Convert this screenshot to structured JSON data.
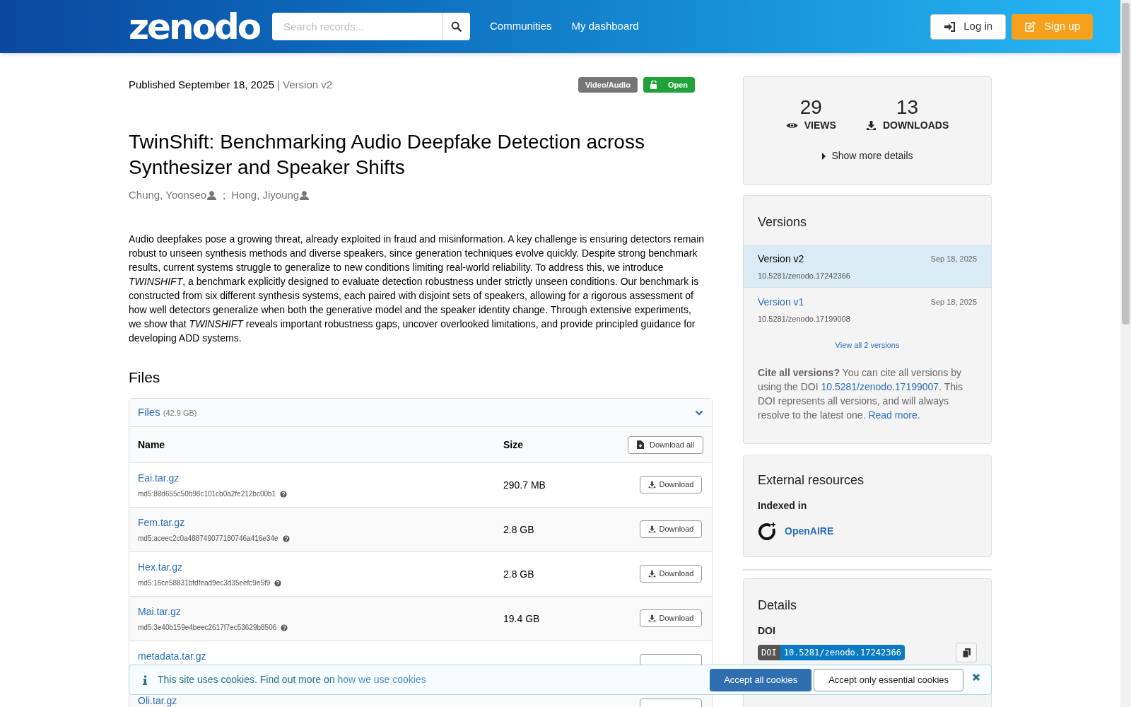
{
  "header": {
    "logo": "zenodo",
    "search": {
      "placeholder": "Search records..."
    },
    "nav": [
      "Communities",
      "My dashboard"
    ],
    "login": "Log in",
    "signup": "Sign up"
  },
  "record": {
    "published": "Published September 18, 2025",
    "version": "| Version v2",
    "badges": [
      {
        "label": "Video/Audio",
        "kind": "type"
      },
      {
        "label": "Open",
        "kind": "access"
      }
    ],
    "title": "TwinShift: Benchmarking Audio Deepfake Detection across Synthesizer and Speaker Shifts",
    "creators": [
      {
        "name": "Chung, Yoonseo"
      },
      {
        "name": "Hong, Jiyoung"
      }
    ],
    "creator_separator": ";",
    "abstract": "Audio deepfakes pose a growing threat, already exploited in fraud and misinformation. A key challenge is ensuring detectors remain robust to unseen synthesis methods and diverse speakers, since generation techniques evolve quickly. Despite strong benchmark results, current systems struggle to generalize to new conditions limiting real-world reliability. To address this, we introduce *TWINSHIFT*, a benchmark explicitly designed to evaluate detection robustness under strictly unseen conditions. Our benchmark is constructed from six different synthesis systems, each paired with disjoint sets of speakers, allowing for a rigorous assessment of how well detectors generalize when both the generative model and the speaker identity change. Through extensive experiments, we show that *TWINSHIFT* reveals important robustness gaps, uncover overlooked limitations, and provide principled guidance for developing ADD systems."
  },
  "files": {
    "heading": "Files",
    "panel_label": "Files",
    "panel_size": "(42.9 GB)",
    "expanded": true,
    "columns": [
      "Name",
      "Size"
    ],
    "download_all": "Download all",
    "rows": [
      {
        "name": "Eai.tar.gz",
        "checksum": "md5:88d655c50b98c101cb0a2fe212bc00b1",
        "size": "290.7 MB",
        "download": "Download"
      },
      {
        "name": "Fem.tar.gz",
        "checksum": "md5:aceec2c0a488749077180746a416e34e",
        "size": "2.8 GB",
        "download": "Download"
      },
      {
        "name": "Hex.tar.gz",
        "checksum": "md5:16ce58831bfdfead9ec3d35eefc9e5f9",
        "size": "2.8 GB",
        "download": "Download"
      },
      {
        "name": "Mai.tar.gz",
        "checksum": "md5:3e40b159e4beec2617f7ec53629b8506",
        "size": "19.4 GB",
        "download": "Download"
      },
      {
        "name": "metadata.tar.gz"
      },
      {
        "name": "Oli.tar.gz"
      }
    ]
  },
  "stats": {
    "items": [
      {
        "value": "29",
        "label": "VIEWS",
        "kind": "views"
      },
      {
        "value": "13",
        "label": "DOWNLOADS",
        "kind": "downloads"
      }
    ],
    "toggle": "Show more details",
    "expanded": false
  },
  "versions": {
    "title": "Versions",
    "items": [
      {
        "label": "Version v2",
        "date": "Sep 18, 2025",
        "doi": "10.5281/zenodo.17242366",
        "selected": true
      },
      {
        "label": "Version v1",
        "date": "Sep 18, 2025",
        "doi": "10.5281/zenodo.17199008",
        "selected": false
      }
    ],
    "view_all": "View all 2 versions",
    "cite": [
      {
        "kind": "bold",
        "text": "Cite all versions?"
      },
      {
        "kind": "plain",
        "text": " You can cite all versions by using the DOI "
      },
      {
        "kind": "link",
        "text": "10.5281/zenodo.17199007"
      },
      {
        "kind": "plain",
        "text": ". This DOI represents all versions, and will always resolve to the latest one. "
      },
      {
        "kind": "link",
        "text": "Read more."
      }
    ]
  },
  "external": {
    "title": "External resources",
    "indexed_label": "Indexed in",
    "items": [
      {
        "name": "OpenAIRE"
      }
    ]
  },
  "details": {
    "title": "Details",
    "doi_label": "DOI",
    "badge_label": "DOI",
    "doi": "10.5281/zenodo.17242366"
  },
  "cookie": {
    "text": "This site uses cookies. Find out more on",
    "link": "how we use cookies",
    "accept": "Accept all cookies",
    "essential": "Accept only essential cookies"
  }
}
